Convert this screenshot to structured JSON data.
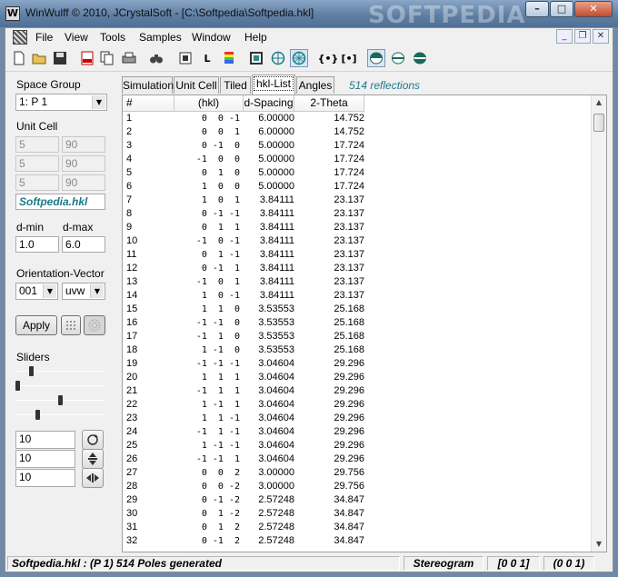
{
  "window": {
    "title": "WinWulff © 2010, JCrystalSoft - [C:\\Softpedia\\Softpedia.hkl]",
    "watermark": "SOFTPEDIA"
  },
  "menu": [
    "File",
    "View",
    "Tools",
    "Samples",
    "Window",
    "Help"
  ],
  "toolbar": {
    "letter_l": "L"
  },
  "left": {
    "space_group_label": "Space Group",
    "space_group_value": "1: P 1",
    "unit_cell_label": "Unit Cell",
    "unit_cell": [
      [
        "5",
        "90"
      ],
      [
        "5",
        "90"
      ],
      [
        "5",
        "90"
      ]
    ],
    "file_label": "Softpedia.hkl",
    "dmin_label": "d-min",
    "dmax_label": "d-max",
    "dmin": "1.0",
    "dmax": "6.0",
    "orientation_label": "Orientation-Vector",
    "orientation_value": "001",
    "orientation_type": "uvw",
    "apply_label": "Apply",
    "sliders_label": "Sliders",
    "sliders": [
      0.16,
      0.0,
      0.5,
      0.24
    ],
    "rotations": [
      "10",
      "10",
      "10"
    ]
  },
  "tabs": [
    "Simulation",
    "Unit Cell",
    "Tiled",
    "hkl-List",
    "Angles"
  ],
  "active_tab": "hkl-List",
  "reflections_info": "514 reflections",
  "table": {
    "headers": [
      "#",
      "(hkl)",
      "d-Spacing",
      "2-Theta"
    ],
    "rows": [
      [
        "1",
        " 0  0 -1",
        "6.00000",
        "14.752"
      ],
      [
        "2",
        " 0  0  1",
        "6.00000",
        "14.752"
      ],
      [
        "3",
        " 0 -1  0",
        "5.00000",
        "17.724"
      ],
      [
        "4",
        "-1  0  0",
        "5.00000",
        "17.724"
      ],
      [
        "5",
        " 0  1  0",
        "5.00000",
        "17.724"
      ],
      [
        "6",
        " 1  0  0",
        "5.00000",
        "17.724"
      ],
      [
        "7",
        " 1  0  1",
        "3.84111",
        "23.137"
      ],
      [
        "8",
        " 0 -1 -1",
        "3.84111",
        "23.137"
      ],
      [
        "9",
        " 0  1  1",
        "3.84111",
        "23.137"
      ],
      [
        "10",
        "-1  0 -1",
        "3.84111",
        "23.137"
      ],
      [
        "11",
        " 0  1 -1",
        "3.84111",
        "23.137"
      ],
      [
        "12",
        " 0 -1  1",
        "3.84111",
        "23.137"
      ],
      [
        "13",
        "-1  0  1",
        "3.84111",
        "23.137"
      ],
      [
        "14",
        " 1  0 -1",
        "3.84111",
        "23.137"
      ],
      [
        "15",
        " 1  1  0",
        "3.53553",
        "25.168"
      ],
      [
        "16",
        "-1 -1  0",
        "3.53553",
        "25.168"
      ],
      [
        "17",
        "-1  1  0",
        "3.53553",
        "25.168"
      ],
      [
        "18",
        " 1 -1  0",
        "3.53553",
        "25.168"
      ],
      [
        "19",
        "-1 -1 -1",
        "3.04604",
        "29.296"
      ],
      [
        "20",
        " 1  1  1",
        "3.04604",
        "29.296"
      ],
      [
        "21",
        "-1  1  1",
        "3.04604",
        "29.296"
      ],
      [
        "22",
        " 1 -1  1",
        "3.04604",
        "29.296"
      ],
      [
        "23",
        " 1  1 -1",
        "3.04604",
        "29.296"
      ],
      [
        "24",
        "-1  1 -1",
        "3.04604",
        "29.296"
      ],
      [
        "25",
        " 1 -1 -1",
        "3.04604",
        "29.296"
      ],
      [
        "26",
        "-1 -1  1",
        "3.04604",
        "29.296"
      ],
      [
        "27",
        " 0  0  2",
        "3.00000",
        "29.756"
      ],
      [
        "28",
        " 0  0 -2",
        "3.00000",
        "29.756"
      ],
      [
        "29",
        " 0 -1 -2",
        "2.57248",
        "34.847"
      ],
      [
        "30",
        " 0  1 -2",
        "2.57248",
        "34.847"
      ],
      [
        "31",
        " 0  1  2",
        "2.57248",
        "34.847"
      ],
      [
        "32",
        " 0 -1  2",
        "2.57248",
        "34.847"
      ]
    ]
  },
  "status": {
    "main": "Softpedia.hkl :  (P 1)  514 Poles generated",
    "view": "Stereogram",
    "zone1": "[0  0  1]",
    "zone2": "(0  0  1)"
  }
}
